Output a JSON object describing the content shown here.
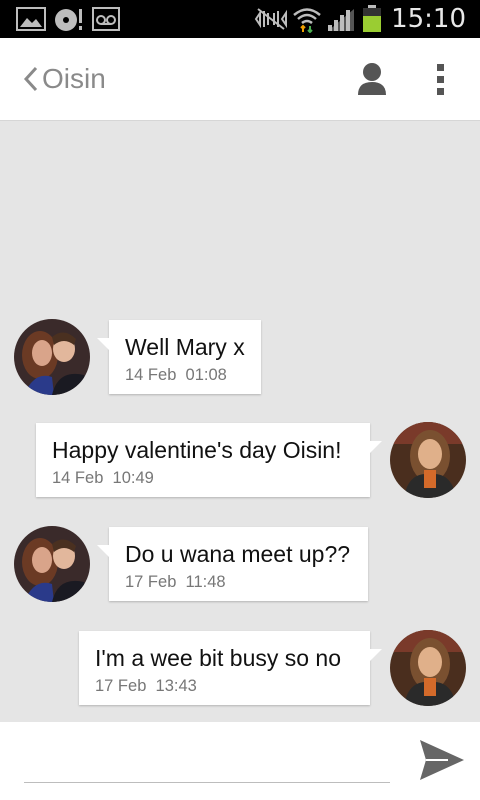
{
  "status_bar": {
    "time": "15:10"
  },
  "header": {
    "contact_name": "Oisin"
  },
  "messages": [
    {
      "direction": "incoming",
      "text": "Well Mary x",
      "date": "14 Feb",
      "time": "01:08"
    },
    {
      "direction": "outgoing",
      "text": "Happy valentine's day Oisin!",
      "date": "14 Feb",
      "time": "10:49"
    },
    {
      "direction": "incoming",
      "text": "Do u wana meet up??",
      "date": "17 Feb",
      "time": "11:48"
    },
    {
      "direction": "outgoing",
      "text": "I'm a wee bit busy so no",
      "date": "17 Feb",
      "time": "13:43"
    }
  ],
  "composer": {
    "value": "",
    "placeholder": ""
  },
  "colors": {
    "status_bar_bg": "#000000",
    "chat_bg": "#e5e5e5",
    "bubble_bg": "#ffffff",
    "accent_icon": "#666666",
    "battery": "#9acd32"
  }
}
